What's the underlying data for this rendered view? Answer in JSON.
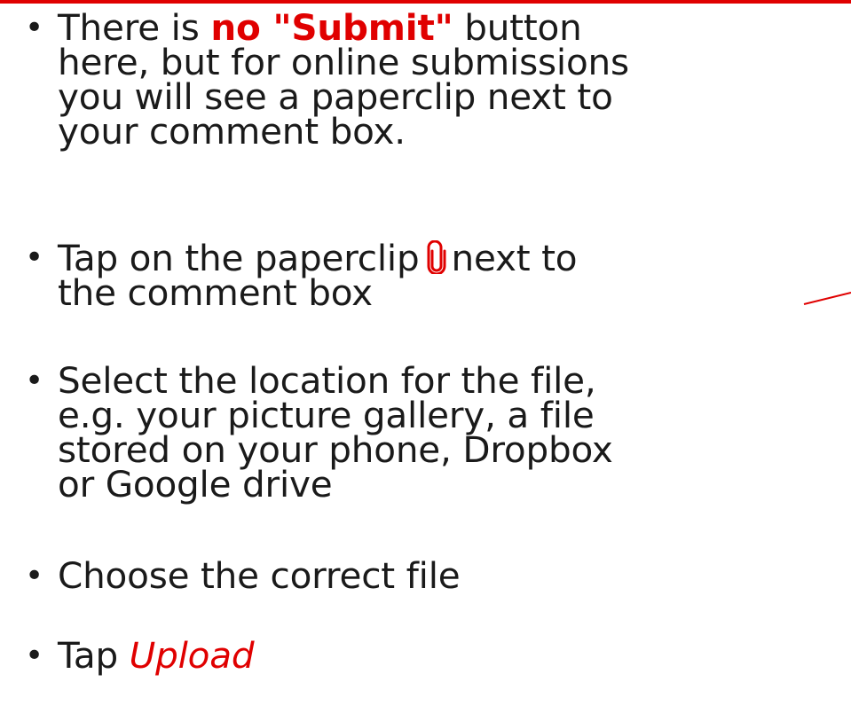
{
  "bullets": [
    {
      "lines": [
        {
          "before": "There is ",
          "highlight": "no \"Submit\"",
          "after": " button"
        },
        {
          "text": "here, but for online submissions"
        },
        {
          "text": "you will see a paperclip next to"
        },
        {
          "text": "your comment box."
        }
      ]
    },
    {
      "lines": [
        {
          "before": "Tap on the paperclip",
          "after": "next to"
        },
        {
          "text": "the comment box"
        }
      ]
    },
    {
      "lines": [
        {
          "text": "Select the location for the file,"
        },
        {
          "text": "e.g. your picture gallery, a file"
        },
        {
          "text": "stored on your phone, Dropbox"
        },
        {
          "text": "or Google drive"
        }
      ]
    },
    {
      "lines": [
        {
          "text": "Choose the correct file"
        }
      ]
    },
    {
      "lines": [
        {
          "before": "Tap ",
          "highlight": "Upload"
        }
      ]
    }
  ],
  "bullet_symbol": "•",
  "icons": {
    "paperclip": "paperclip-icon"
  },
  "colors": {
    "accent": "#e00000",
    "text": "#1a1a1a",
    "background": "#ffffff"
  }
}
